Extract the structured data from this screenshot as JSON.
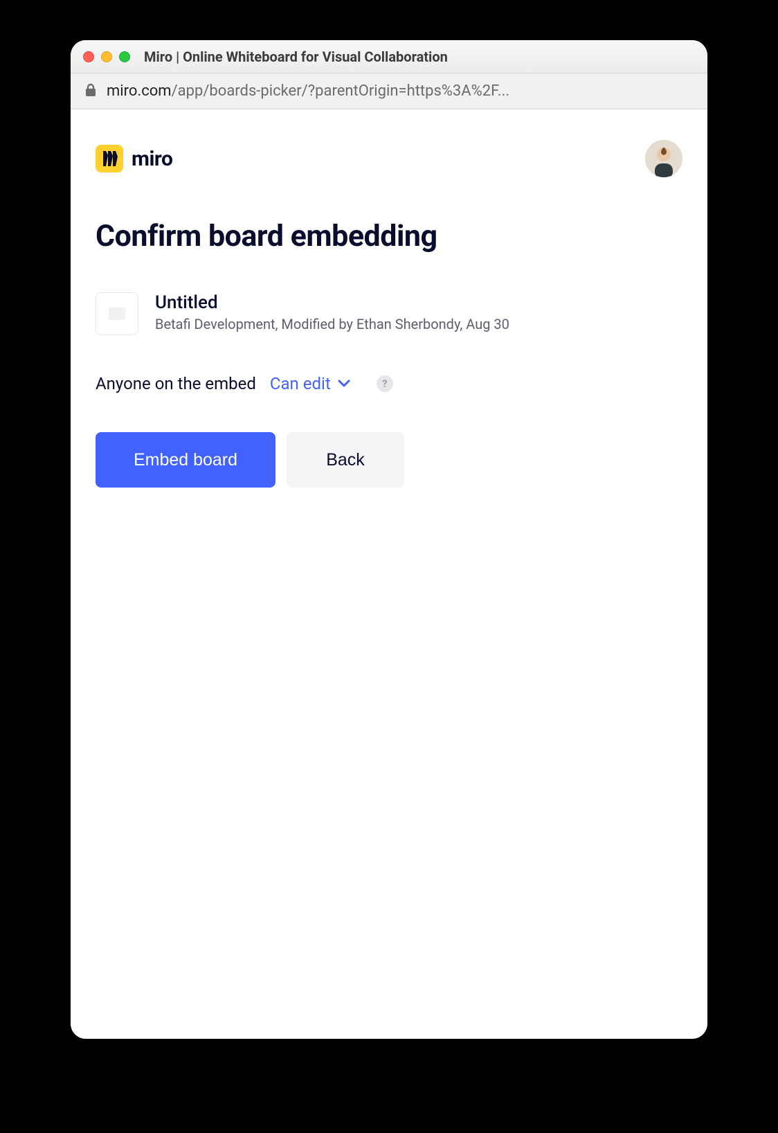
{
  "window": {
    "title": "Miro | Online Whiteboard for Visual Collaboration",
    "url_host": "miro.com",
    "url_path": "/app/boards-picker/?parentOrigin=https%3A%2F..."
  },
  "brand": {
    "name": "miro"
  },
  "page": {
    "title": "Confirm board embedding"
  },
  "board": {
    "name": "Untitled",
    "meta": "Betafi Development, Modified by Ethan Sherbondy, Aug 30"
  },
  "permissions": {
    "scope_label": "Anyone on the embed",
    "selected": "Can edit",
    "help_glyph": "?"
  },
  "buttons": {
    "primary": "Embed board",
    "secondary": "Back"
  }
}
